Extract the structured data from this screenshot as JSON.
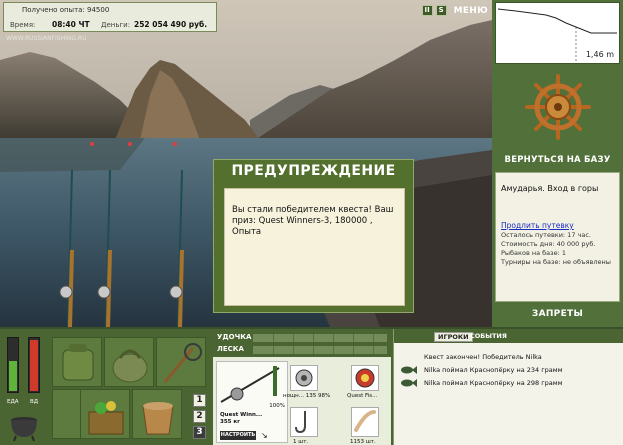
{
  "info": {
    "experience_text": "Получено опыта: 94500",
    "time_label": "Время:",
    "time_value": "08:40 ЧТ",
    "money_label": "Деньги:",
    "money_value": "252 054 490 руб."
  },
  "watermark": "WWW.RUSSIANFISHING.RU",
  "top_buttons": {
    "pause": "II",
    "sound": "S",
    "menu": "МЕНЮ"
  },
  "dialog": {
    "title": "ПРЕДУПРЕЖДЕНИЕ",
    "message": "Вы стали победителем квеста! Ваш приз: Quest Winners-3, 180000 , Опыта"
  },
  "depth": {
    "value": "1,46 m"
  },
  "right_panel": {
    "back_to_base": "ВЕРНУТЬСЯ НА БАЗУ",
    "location": "Амударья. Вход в горы",
    "extend_trip": "Продлить путевку",
    "stats": [
      "Осталось путевки: 17 час.",
      "Стоимость дня: 40 000 руб.",
      "Рыбаков на базе: 1",
      "Турниры на базе: не объявлены"
    ],
    "bans": "ЗАПРЕТЫ"
  },
  "status_bars": {
    "food_label": "ЕДА",
    "alcohol_label": "ВД",
    "food_level": 0.55,
    "alcohol_level": 0.95
  },
  "kit_numbers": [
    "1",
    "2",
    "3"
  ],
  "tackle": {
    "rod_label": "УДОЧКА",
    "line_label": "ЛЕСКА",
    "rod_name": "Quest Winn...",
    "rod_weight": "355 кг",
    "rod_condition": "100%",
    "setup_button": "НАСТРОИТЬ",
    "reel_caption": "нощн... 135",
    "reel_percent": "98%",
    "line_caption": "Quest Fis...",
    "hook_caption": "1 шт.",
    "bait_caption": "1153 шт."
  },
  "chat": {
    "tabs": [
      "ИГРОКИ",
      "СОБЫТИЯ"
    ],
    "messages": [
      "Квест закончен! Победитель Nilka",
      "Nilka поймал Краснопёрку на 234 грамм",
      "Nilka поймал Краснопёрку на 298 грамм"
    ]
  }
}
